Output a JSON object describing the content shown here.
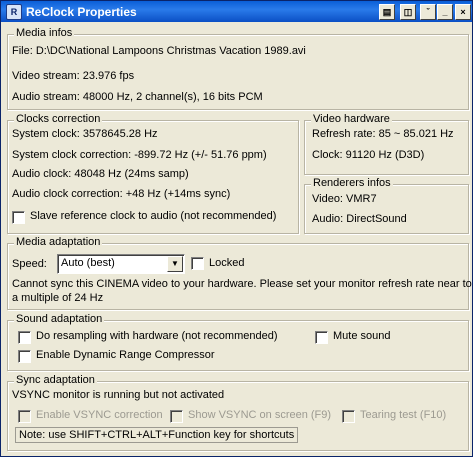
{
  "window": {
    "title": "ReClock Properties",
    "icon": "reclock-app-icon"
  },
  "media_infos": {
    "legend": "Media infos",
    "file": "File: D:\\DC\\National Lampoons Christmas Vacation 1989.avi",
    "video_stream": "Video stream: 23.976 fps",
    "audio_stream": "Audio stream: 48000 Hz, 2 channel(s), 16 bits PCM"
  },
  "clocks": {
    "legend": "Clocks correction",
    "system_clock": "System clock: 3578645.28 Hz",
    "system_correction": "System clock correction: -899.72 Hz (+/- 51.76 ppm)",
    "audio_clock": "Audio clock: 48048 Hz (24ms samp)",
    "audio_correction": "Audio clock correction: +48 Hz (+14ms sync)",
    "slave_label": "Slave reference clock to audio (not recommended)"
  },
  "video_hw": {
    "legend": "Video hardware",
    "refresh": "Refresh rate: 85 ~ 85.021 Hz",
    "clock": "Clock: 91120 Hz (D3D)"
  },
  "renderers": {
    "legend": "Renderers infos",
    "video": "Video: VMR7",
    "audio": "Audio: DirectSound"
  },
  "media_adapt": {
    "legend": "Media adaptation",
    "speed_label": "Speed:",
    "speed_value": "Auto (best)",
    "locked_label": "Locked",
    "message_line1": "Cannot sync this CINEMA video to your hardware. Please set your monitor refresh rate near to",
    "message_line2": "a multiple of 24 Hz"
  },
  "sound_adapt": {
    "legend": "Sound adaptation",
    "resampling_label": "Do resampling with hardware (not recommended)",
    "mute_label": "Mute sound",
    "drc_label": "Enable Dynamic Range Compressor"
  },
  "sync_adapt": {
    "legend": "Sync adaptation",
    "status": "VSYNC monitor is running but not activated",
    "enable_vsync": "Enable VSYNC correction",
    "show_vsync": "Show VSYNC on screen (F9)",
    "tearing": "Tearing test (F10)",
    "note": "Note: use SHIFT+CTRL+ALT+Function key for shortcuts"
  }
}
